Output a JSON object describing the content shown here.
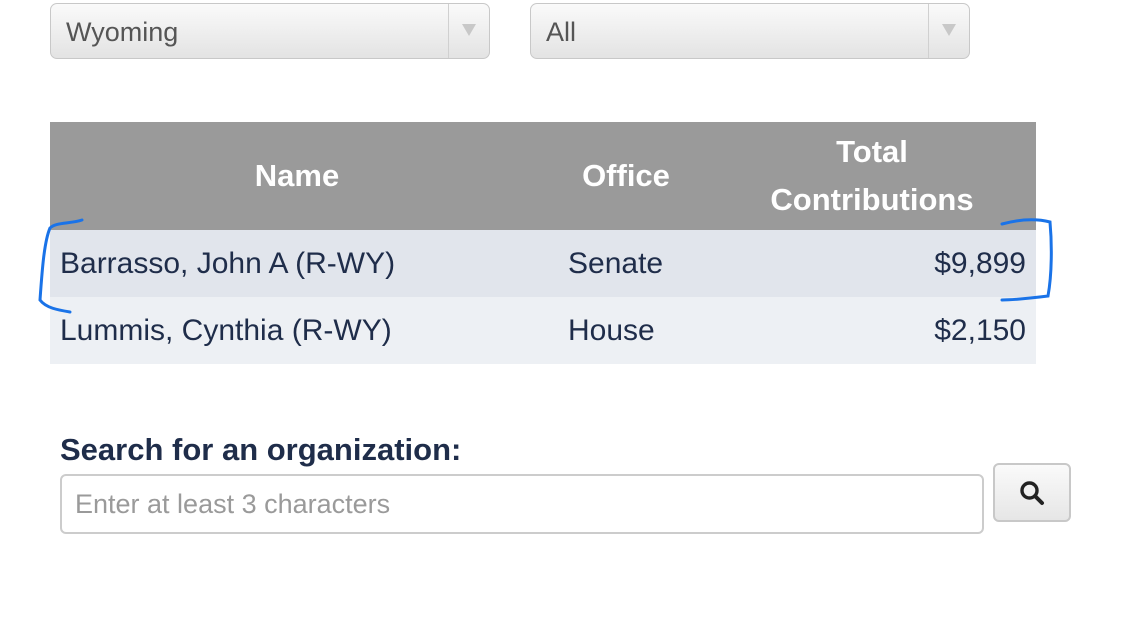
{
  "filters": {
    "state": {
      "selected": "Wyoming"
    },
    "office": {
      "selected": "All"
    }
  },
  "table": {
    "headers": {
      "name": "Name",
      "office": "Office",
      "total_line1": "Total",
      "total_line2": "Contributions"
    },
    "rows": [
      {
        "name": "Barrasso, John A (R-WY)",
        "office": "Senate",
        "total": "$9,899"
      },
      {
        "name": "Lummis, Cynthia (R-WY)",
        "office": "House",
        "total": "$2,150"
      }
    ]
  },
  "search": {
    "label": "Search for an organization:",
    "placeholder": "Enter at least 3 characters",
    "value": ""
  },
  "icons": {
    "dropdown": "chevron-down-icon",
    "search": "search-icon"
  },
  "colors": {
    "header_bg": "#9a9a9a",
    "row_highlight": "#e1e5ec",
    "row_alt": "#edf0f4",
    "text_dark": "#1f2d4a",
    "annotation": "#1a73e8"
  }
}
